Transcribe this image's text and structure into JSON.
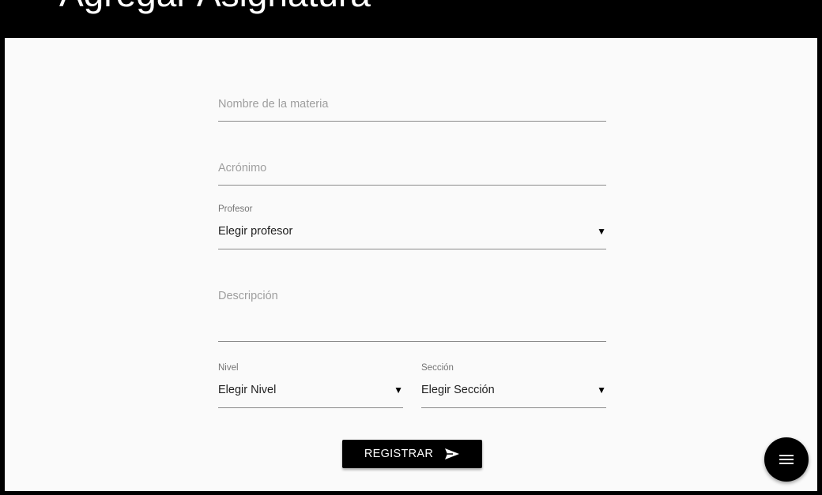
{
  "header": {
    "title": "Agregar Asignatura"
  },
  "form": {
    "subject_name_placeholder": "Nombre de la materia",
    "acronym_placeholder": "Acrónimo",
    "teacher": {
      "label": "Profesor",
      "selected": "Elegir profesor"
    },
    "description_placeholder": "Descripción",
    "level": {
      "label": "Nivel",
      "selected": "Elegir Nivel"
    },
    "section": {
      "label": "Sección",
      "selected": "Elegir Sección"
    },
    "submit_label": "REGISTRAR"
  },
  "icons": {
    "submit": "send-icon",
    "fab": "menu-icon",
    "select_caret": "caret-down-icon"
  },
  "colors": {
    "primary": "#000000",
    "panel_background": "#fafafa",
    "placeholder": "#9e9e9e"
  }
}
